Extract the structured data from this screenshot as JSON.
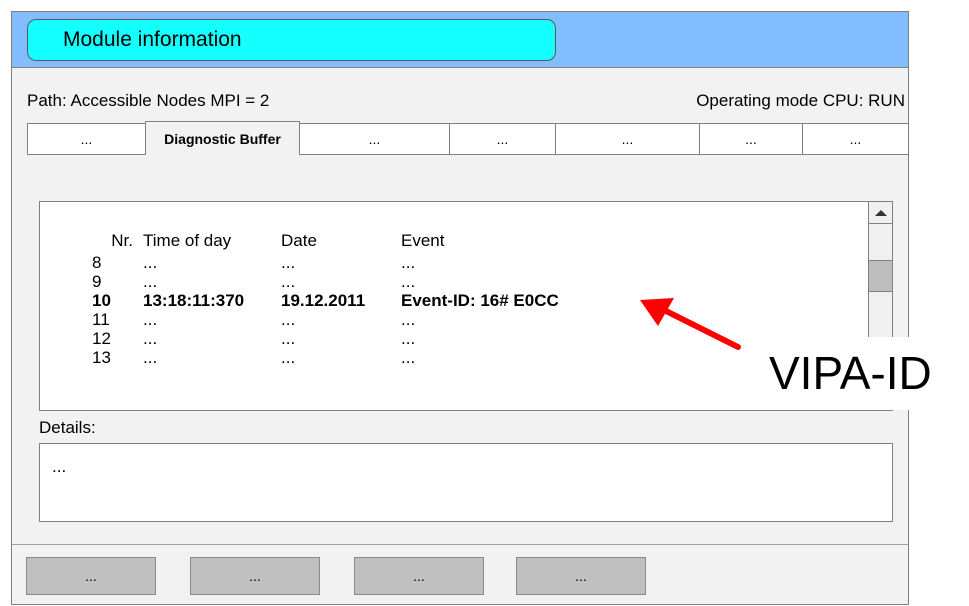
{
  "window": {
    "title": "Module information"
  },
  "status": {
    "path": "Path: Accessible Nodes MPI = 2",
    "operating_mode": "Operating mode CPU: RUN"
  },
  "tabs": [
    {
      "label": "...",
      "active": false
    },
    {
      "label": "Diagnostic Buffer",
      "active": true
    },
    {
      "label": "...",
      "active": false
    },
    {
      "label": "...",
      "active": false
    },
    {
      "label": "...",
      "active": false
    },
    {
      "label": "...",
      "active": false
    },
    {
      "label": "...",
      "active": false
    }
  ],
  "diagnostic_buffer": {
    "columns": [
      "Nr.",
      "Time of day",
      "Date",
      "Event"
    ],
    "rows": [
      {
        "nr": "8",
        "time": "...",
        "date": "...",
        "event": "...",
        "selected": false
      },
      {
        "nr": "9",
        "time": "...",
        "date": "...",
        "event": "...",
        "selected": false
      },
      {
        "nr": "10",
        "time": "13:18:11:370",
        "date": "19.12.2011",
        "event": "Event-ID: 16# E0CC",
        "selected": true
      },
      {
        "nr": "11",
        "time": "...",
        "date": "...",
        "event": "...",
        "selected": false
      },
      {
        "nr": "12",
        "time": "...",
        "date": "...",
        "event": "...",
        "selected": false
      },
      {
        "nr": "13",
        "time": "...",
        "date": "...",
        "event": "...",
        "selected": false
      }
    ]
  },
  "details": {
    "label": "Details:",
    "text": "..."
  },
  "buttons": [
    "...",
    "...",
    "...",
    "..."
  ],
  "annotation": {
    "text": "VIPA-ID",
    "arrow_color": "#ff0000"
  },
  "colors": {
    "titlebar": "#82bdff",
    "title_pill": "#16ffff",
    "window_bg": "#f2f2f2",
    "button": "#c0c0c0"
  }
}
